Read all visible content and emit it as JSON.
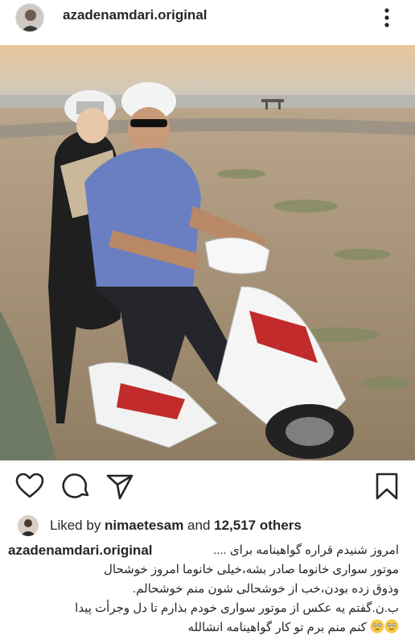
{
  "post": {
    "username": "azadenamdari.original",
    "liked_by_prefix": "Liked by ",
    "liked_by_user": "nimaetesam",
    "liked_by_middle": " and ",
    "liked_by_count": "12,517 others",
    "caption_username": "azadenamdari.original",
    "caption_lines": [
      "امروز شنیدم قراره گواهینامه برای ....",
      "موتور سواری خانوما صادر بشه،خیلی خانوما امروز خوشحال",
      "وذوق زده بودن،خب از خوشحالی شون منم خوشحالم.",
      "ب.ن.گفتم یه عکس از موتور سواری خودم بذارم تا دل وجرأت پیدا",
      "کنم منم برم تو کار گواهینامه انشالله"
    ]
  },
  "icons": {
    "more": "more-vertical-icon",
    "like": "heart-icon",
    "comment": "comment-icon",
    "share": "paper-plane-icon",
    "save": "bookmark-icon",
    "tag": "user-tag-icon",
    "emoji": "flushed-face-emoji"
  },
  "colors": {
    "text": "#262626",
    "background": "#ffffff"
  }
}
